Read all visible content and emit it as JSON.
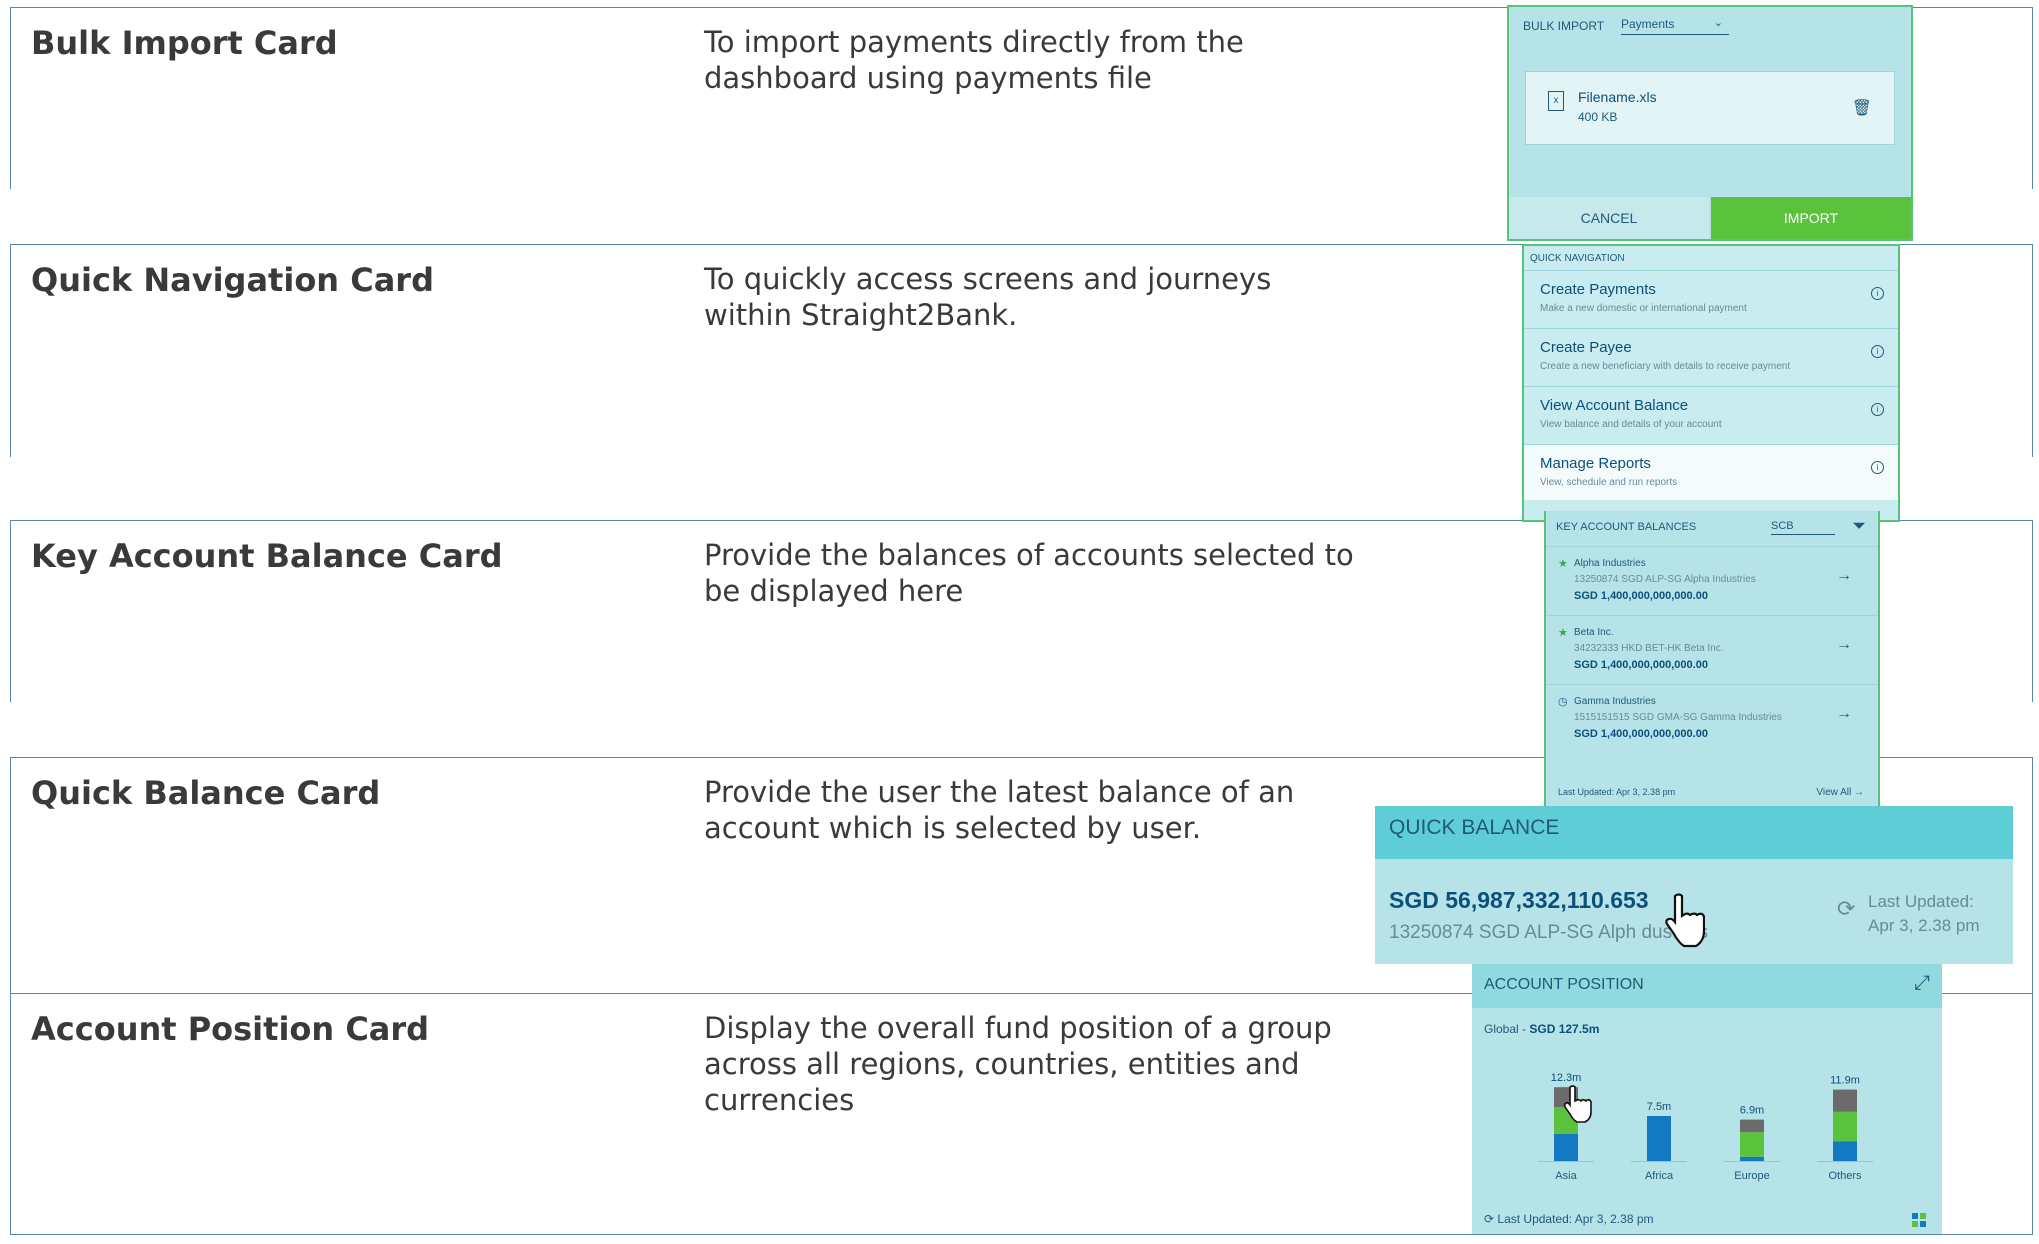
{
  "rows": [
    {
      "title": "Bulk Import Card",
      "desc": "To import payments directly from the dashboard using payments file"
    },
    {
      "title": "Quick Navigation Card",
      "desc": "To quickly access screens and journeys within Straight2Bank."
    },
    {
      "title": "Key Account Balance Card",
      "desc": "Provide the balances of accounts selected to be displayed here"
    },
    {
      "title": "Quick Balance Card",
      "desc": "Provide the user the latest balance of an account which is selected by user."
    },
    {
      "title": "Account Position Card",
      "desc": "Display the overall fund position of a group across all regions, countries, entities and currencies"
    }
  ],
  "bulk_import": {
    "header": "BULK IMPORT",
    "dropdown": "Payments",
    "file_name": "Filename.xls",
    "file_size": "400 KB",
    "cancel": "CANCEL",
    "import": "IMPORT",
    "icons": [
      "xls-file-icon",
      "trash-icon",
      "chevron-down-icon"
    ]
  },
  "quick_navigation": {
    "header": "QUICK NAVIGATION",
    "items": [
      {
        "title": "Create Payments",
        "subtitle": "Make a new domestic or international payment"
      },
      {
        "title": "Create Payee",
        "subtitle": "Create a new beneficiary with details to receive payment"
      },
      {
        "title": "View Account Balance",
        "subtitle": "View balance and details of your account"
      },
      {
        "title": "Manage Reports",
        "subtitle": "View, schedule and run reports"
      }
    ]
  },
  "key_account_balances": {
    "header": "KEY ACCOUNT BALANCES",
    "select": "SCB",
    "accounts": [
      {
        "name": "Alpha Industries",
        "detail": "13250874 SGD ALP-SG Alpha Industries",
        "balance": "SGD 1,400,000,000,000.00",
        "marker": "★"
      },
      {
        "name": "Beta Inc.",
        "detail": "34232333 HKD BET-HK Beta Inc.",
        "balance": "SGD 1,400,000,000,000.00",
        "marker": "★"
      },
      {
        "name": "Gamma Industries",
        "detail": "1515151515 SGD GMA-SG Gamma Industries",
        "balance": "SGD 1,400,000,000,000.00",
        "marker": "◷"
      }
    ],
    "footer": "Last Updated: Apr 3, 2.38 pm",
    "view_all": "View All →"
  },
  "quick_balance": {
    "header": "QUICK BALANCE",
    "amount": "SGD 56,987,332,110.653",
    "account": "13250874 SGD ALP-SG Alph   dustries",
    "last_updated_label": "Last Updated:",
    "last_updated_value": "Apr 3, 2.38 pm"
  },
  "account_position": {
    "header": "ACCOUNT POSITION",
    "global_label": "Global - ",
    "global_value": "SGD 127.5m",
    "footer": "Last Updated: Apr 3, 2.38 pm",
    "colors": {
      "blue": "#1479c3",
      "green": "#5bc23d",
      "grey": "#6b6b6b"
    }
  },
  "chart_data": {
    "type": "bar",
    "categories": [
      "Asia",
      "Africa",
      "Europe",
      "Others"
    ],
    "totals": [
      12.3,
      7.5,
      6.9,
      11.9
    ],
    "total_labels": [
      "12.3m",
      "7.5m",
      "6.9m",
      "11.9m"
    ],
    "series": [
      {
        "values": [
          4.5,
          7.5,
          0.7,
          3.3
        ]
      },
      {
        "values": [
          4.5,
          0,
          4.1,
          4.9
        ]
      },
      {
        "values": [
          3.3,
          0,
          2.1,
          3.7
        ]
      }
    ]
  }
}
